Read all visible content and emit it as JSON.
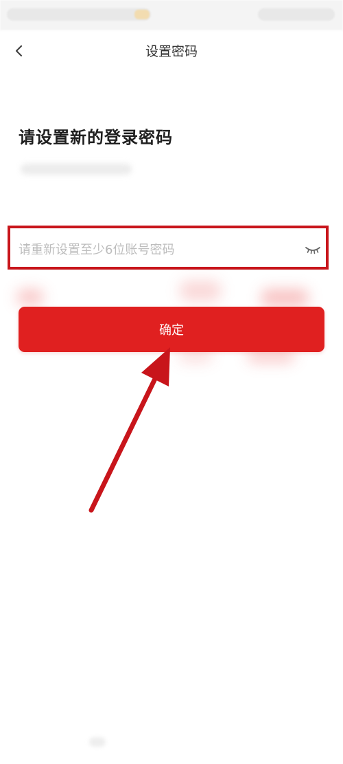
{
  "nav": {
    "title": "设置密码",
    "back_icon": "chevron-left-icon"
  },
  "heading": "请设置新的登录密码",
  "password": {
    "value": "",
    "placeholder": "请重新设置至少6位账号密码",
    "toggle_icon": "eye-closed-icon"
  },
  "confirm_label": "确定",
  "colors": {
    "accent": "#e02020",
    "annotation": "#c8151b",
    "placeholder": "#bdbdbd"
  }
}
